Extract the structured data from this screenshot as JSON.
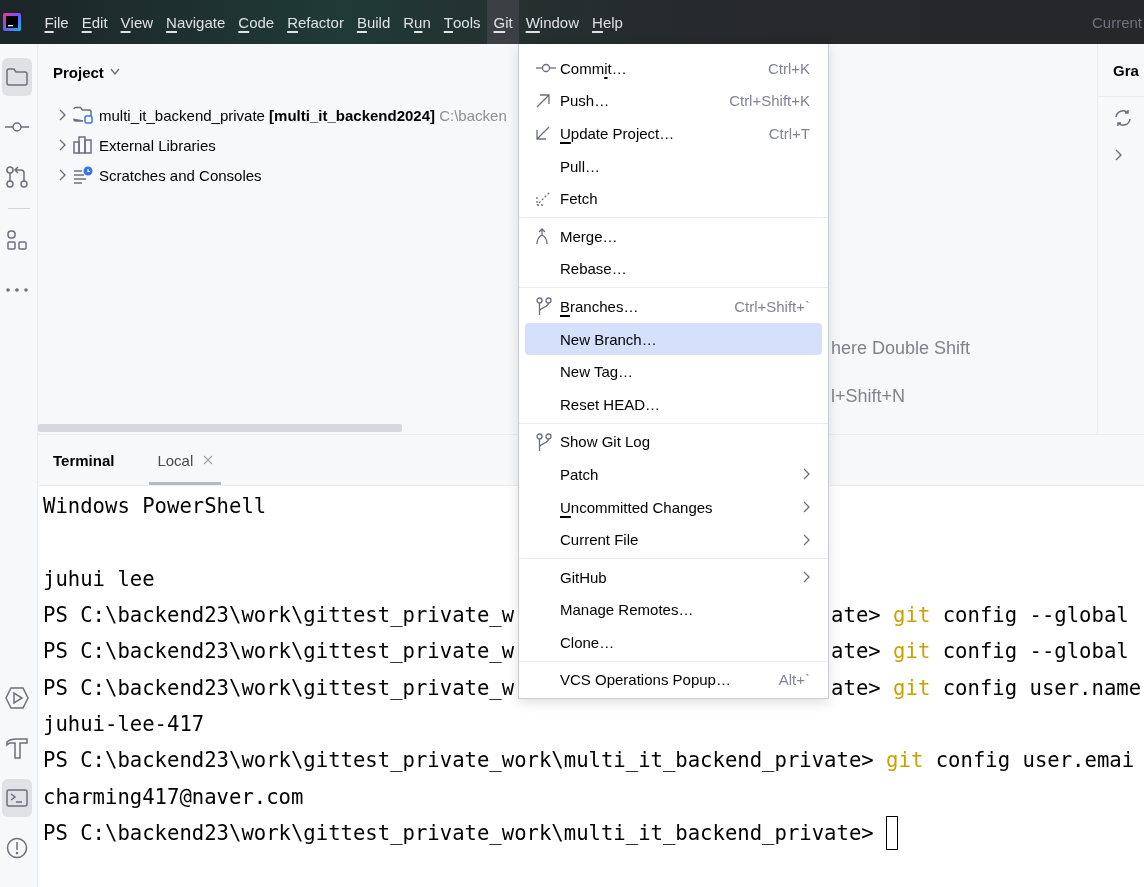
{
  "menubar": {
    "items": [
      {
        "key": "F",
        "post": "ile",
        "selected": false
      },
      {
        "key": "E",
        "post": "dit",
        "selected": false
      },
      {
        "key": "V",
        "post": "iew",
        "selected": false
      },
      {
        "key": "N",
        "post": "avigate",
        "selected": false
      },
      {
        "key": "C",
        "post": "ode",
        "selected": false
      },
      {
        "key": "R",
        "post": "efactor",
        "selected": false
      },
      {
        "key": "B",
        "post": "uild",
        "selected": false
      },
      {
        "pre": "R",
        "key": "u",
        "post": "n",
        "selected": false
      },
      {
        "key": "T",
        "post": "ools",
        "selected": false
      },
      {
        "key": "G",
        "post": "it",
        "selected": true
      },
      {
        "key": "W",
        "post": "indow",
        "selected": false
      },
      {
        "key": "H",
        "post": "elp",
        "selected": false
      }
    ],
    "right_text": "Current"
  },
  "tool_strip": {
    "top": [
      {
        "selected": true
      },
      {
        "selected": false
      },
      {
        "selected": false
      },
      {
        "selected": false
      },
      {
        "selected": false
      }
    ],
    "bottom": [
      {
        "selected": false
      },
      {
        "selected": false
      },
      {
        "selected": true
      },
      {
        "selected": false
      }
    ]
  },
  "project": {
    "title": "Project",
    "tree": [
      {
        "name": "multi_it_backend_private",
        "module": "[multi_it_backend2024]",
        "path": "C:\\backen",
        "expanded": false
      },
      {
        "name": "External Libraries",
        "expanded": false
      },
      {
        "name": "Scratches and Consoles",
        "expanded": false
      }
    ]
  },
  "editor_hints": [
    "here Double Shift",
    "l+Shift+N"
  ],
  "gradle": {
    "title": "Gra"
  },
  "terminal": {
    "title": "Terminal",
    "tabs": [
      {
        "label": "Local",
        "selected": true
      }
    ],
    "lines": [
      {
        "kind": "output",
        "text": "Windows PowerShell"
      },
      {
        "kind": "blank"
      },
      {
        "kind": "output",
        "text": "juhui lee"
      },
      {
        "kind": "covered",
        "before": "PS C:\\backend23\\work\\gittest_private_w",
        "after": "ate>",
        "command": "git",
        "args": "config --global"
      },
      {
        "kind": "covered",
        "before": "PS C:\\backend23\\work\\gittest_private_w",
        "after": "ate>",
        "command": "git",
        "args": "config --global"
      },
      {
        "kind": "covered",
        "before": "PS C:\\backend23\\work\\gittest_private_w",
        "after": "ate>",
        "command": "git",
        "args": "config user.name"
      },
      {
        "kind": "output",
        "text": "juhui-lee-417"
      },
      {
        "kind": "prompt",
        "prompt": "PS C:\\backend23\\work\\gittest_private_work\\multi_it_backend_private>",
        "command": "git",
        "args": "config user.emai"
      },
      {
        "kind": "output",
        "text": "charming417@naver.com"
      },
      {
        "kind": "prompt",
        "prompt": "PS C:\\backend23\\work\\gittest_private_work\\multi_it_backend_private>",
        "cursor": true
      }
    ]
  },
  "git_menu": {
    "groups": [
      [
        {
          "pre": "Comm",
          "key": "i",
          "post": "t…",
          "shortcut": "Ctrl+K",
          "submenu": false,
          "selected": false
        },
        {
          "post": "Push…",
          "shortcut": "Ctrl+Shift+K",
          "submenu": false,
          "selected": false
        },
        {
          "key": "U",
          "post": "pdate Project…",
          "shortcut": "Ctrl+T",
          "submenu": false,
          "selected": false
        },
        {
          "post": "Pull…",
          "submenu": false,
          "selected": false
        },
        {
          "post": "Fetch",
          "submenu": false,
          "selected": false
        }
      ],
      [
        {
          "post": "Merge…",
          "submenu": false,
          "selected": false
        },
        {
          "post": "Rebase…",
          "submenu": false,
          "selected": false
        }
      ],
      [
        {
          "key": "B",
          "post": "ranches…",
          "shortcut": "Ctrl+Shift+`",
          "submenu": false,
          "selected": false
        },
        {
          "post": "New Branch…",
          "submenu": false,
          "selected": true
        },
        {
          "post": "New Tag…",
          "submenu": false,
          "selected": false
        },
        {
          "post": "Reset HEAD…",
          "submenu": false,
          "selected": false
        }
      ],
      [
        {
          "post": "Show Git Log",
          "submenu": false,
          "selected": false
        },
        {
          "post": "Patch",
          "submenu": true,
          "selected": false
        },
        {
          "key": "U",
          "post": "ncommitted Changes",
          "submenu": true,
          "selected": false
        },
        {
          "post": "Current File",
          "submenu": true,
          "selected": false
        }
      ],
      [
        {
          "post": "GitHub",
          "submenu": true,
          "selected": false
        },
        {
          "post": "Manage Remotes…",
          "submenu": false,
          "selected": false
        },
        {
          "post": "Clone…",
          "submenu": false,
          "selected": false
        }
      ],
      [
        {
          "post": "VCS Operations Popup…",
          "shortcut": "Alt+`",
          "submenu": false,
          "selected": false
        }
      ]
    ]
  }
}
